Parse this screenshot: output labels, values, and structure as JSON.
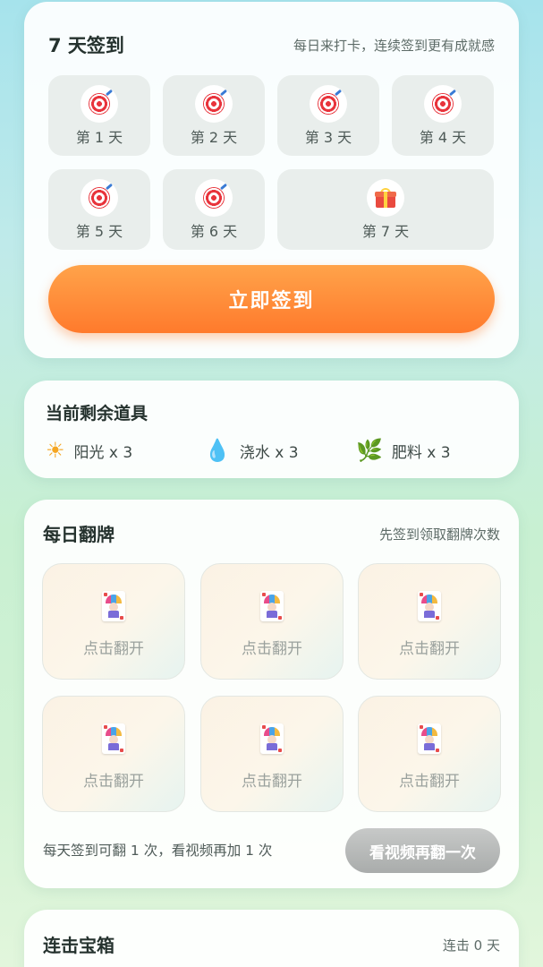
{
  "signin": {
    "title": "7 天签到",
    "subtitle": "每日来打卡，连续签到更有成就感",
    "days": [
      {
        "label": "第 1 天",
        "icon": "target-icon"
      },
      {
        "label": "第 2 天",
        "icon": "target-icon"
      },
      {
        "label": "第 3 天",
        "icon": "target-icon"
      },
      {
        "label": "第 4 天",
        "icon": "target-icon"
      },
      {
        "label": "第 5 天",
        "icon": "target-icon"
      },
      {
        "label": "第 6 天",
        "icon": "target-icon"
      },
      {
        "label": "第 7 天",
        "icon": "gift-icon"
      }
    ],
    "button_label": "立即签到"
  },
  "props": {
    "title": "当前剩余道具",
    "items": [
      {
        "icon": "sun-icon",
        "label": "阳光 x 3"
      },
      {
        "icon": "water-drop-icon",
        "label": "浇水 x 3"
      },
      {
        "icon": "leaf-icon",
        "label": "肥料 x 3"
      }
    ]
  },
  "flip": {
    "title": "每日翻牌",
    "subtitle": "先签到领取翻牌次数",
    "cards": [
      {
        "label": "点击翻开",
        "icon": "joker-card-icon"
      },
      {
        "label": "点击翻开",
        "icon": "joker-card-icon"
      },
      {
        "label": "点击翻开",
        "icon": "joker-card-icon"
      },
      {
        "label": "点击翻开",
        "icon": "joker-card-icon"
      },
      {
        "label": "点击翻开",
        "icon": "joker-card-icon"
      },
      {
        "label": "点击翻开",
        "icon": "joker-card-icon"
      }
    ],
    "hint": "每天签到可翻 1 次，看视频再加 1 次",
    "video_button_label": "看视频再翻一次"
  },
  "chest": {
    "title": "连击宝箱",
    "streak": "连击 0 天"
  },
  "colors": {
    "accent_orange": "#ff8a33",
    "disabled_gray": "#b3b6b5",
    "background_top": "#a6e3ec",
    "background_bottom": "#e2f6dc"
  }
}
